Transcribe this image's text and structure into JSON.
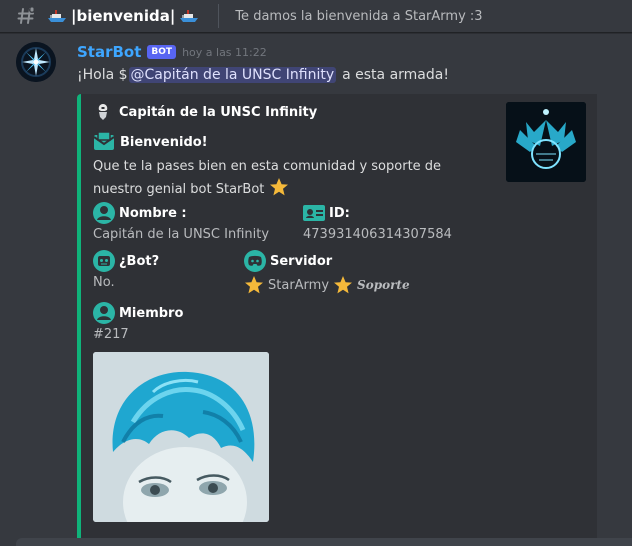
{
  "header": {
    "channel_name": "|bienvenida|",
    "topic": "Te damos la bienvenida a StarArmy :3"
  },
  "message": {
    "username": "StarBot",
    "bot_tag": "BOT",
    "timestamp": "hoy a las 11:22",
    "greeting": "¡Hola $",
    "mention": "@Capitán de la UNSC Infinity",
    "greeting_end": "a esta armada!"
  },
  "embed": {
    "color": "#0fb37a",
    "author": "Capitán de la UNSC Infinity",
    "title": "Bienvenido!",
    "description": "Que te la pases bien en esta comunidad y soporte de nuestro genial bot StarBot",
    "fields": {
      "name": {
        "label": "Nombre :",
        "value": "Capitán de la UNSC Infinity",
        "icon": "user-icon"
      },
      "id": {
        "label": "ID:",
        "value": "473931406314307584",
        "icon": "id-card-icon"
      },
      "bot": {
        "label": "¿Bot?",
        "value": "No.",
        "icon": "robot-icon"
      },
      "server": {
        "label": "Servidor",
        "value": "StarArmy",
        "badge": "Soporte",
        "icon": "discord-icon"
      },
      "member": {
        "label": "Miembro",
        "value": "#217",
        "icon": "user-icon"
      }
    }
  },
  "colors": {
    "username": "#3ea6ff",
    "bot_tag": "#5865f2",
    "icon_teal": "#2bb5a6",
    "star": "#f5b93a"
  }
}
